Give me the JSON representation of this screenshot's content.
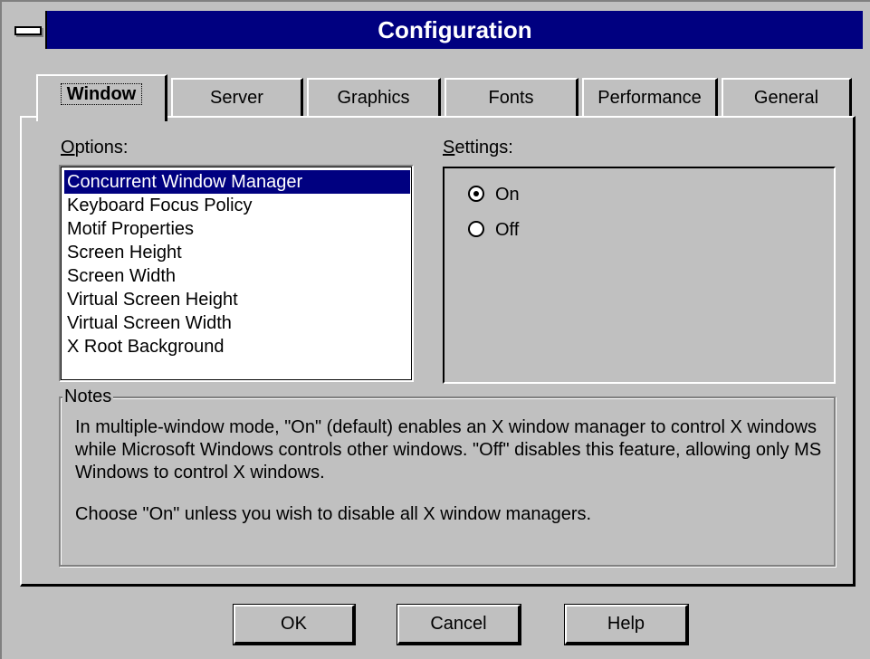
{
  "window": {
    "title": "Configuration"
  },
  "tabs": [
    {
      "label": "Window",
      "active": true
    },
    {
      "label": "Server"
    },
    {
      "label": "Graphics"
    },
    {
      "label": "Fonts"
    },
    {
      "label": "Performance"
    },
    {
      "label": "General"
    }
  ],
  "options": {
    "label_mnemonic": "O",
    "label_rest": "ptions:",
    "items": [
      "Concurrent Window Manager",
      "Keyboard Focus Policy",
      "Motif Properties",
      "Screen Height",
      "Screen Width",
      "Virtual Screen Height",
      "Virtual Screen Width",
      "X Root Background"
    ],
    "selected": "Concurrent Window Manager"
  },
  "settings": {
    "label_mnemonic": "S",
    "label_rest": "ettings:",
    "radios": [
      {
        "label": "On",
        "checked": true
      },
      {
        "label": "Off",
        "checked": false
      }
    ]
  },
  "notes": {
    "legend": "Notes",
    "paragraphs": [
      "In multiple-window mode, \"On\" (default) enables an X window manager to control X windows while Microsoft Windows controls other windows. \"Off\" disables this feature, allowing only MS Windows to control X windows.",
      "Choose \"On\" unless you wish to disable all X window managers."
    ]
  },
  "buttons": {
    "ok": "OK",
    "cancel": "Cancel",
    "help": "Help"
  },
  "colors": {
    "face": "#c0c0c0",
    "titlebar": "#000080",
    "selection": "#000080"
  }
}
